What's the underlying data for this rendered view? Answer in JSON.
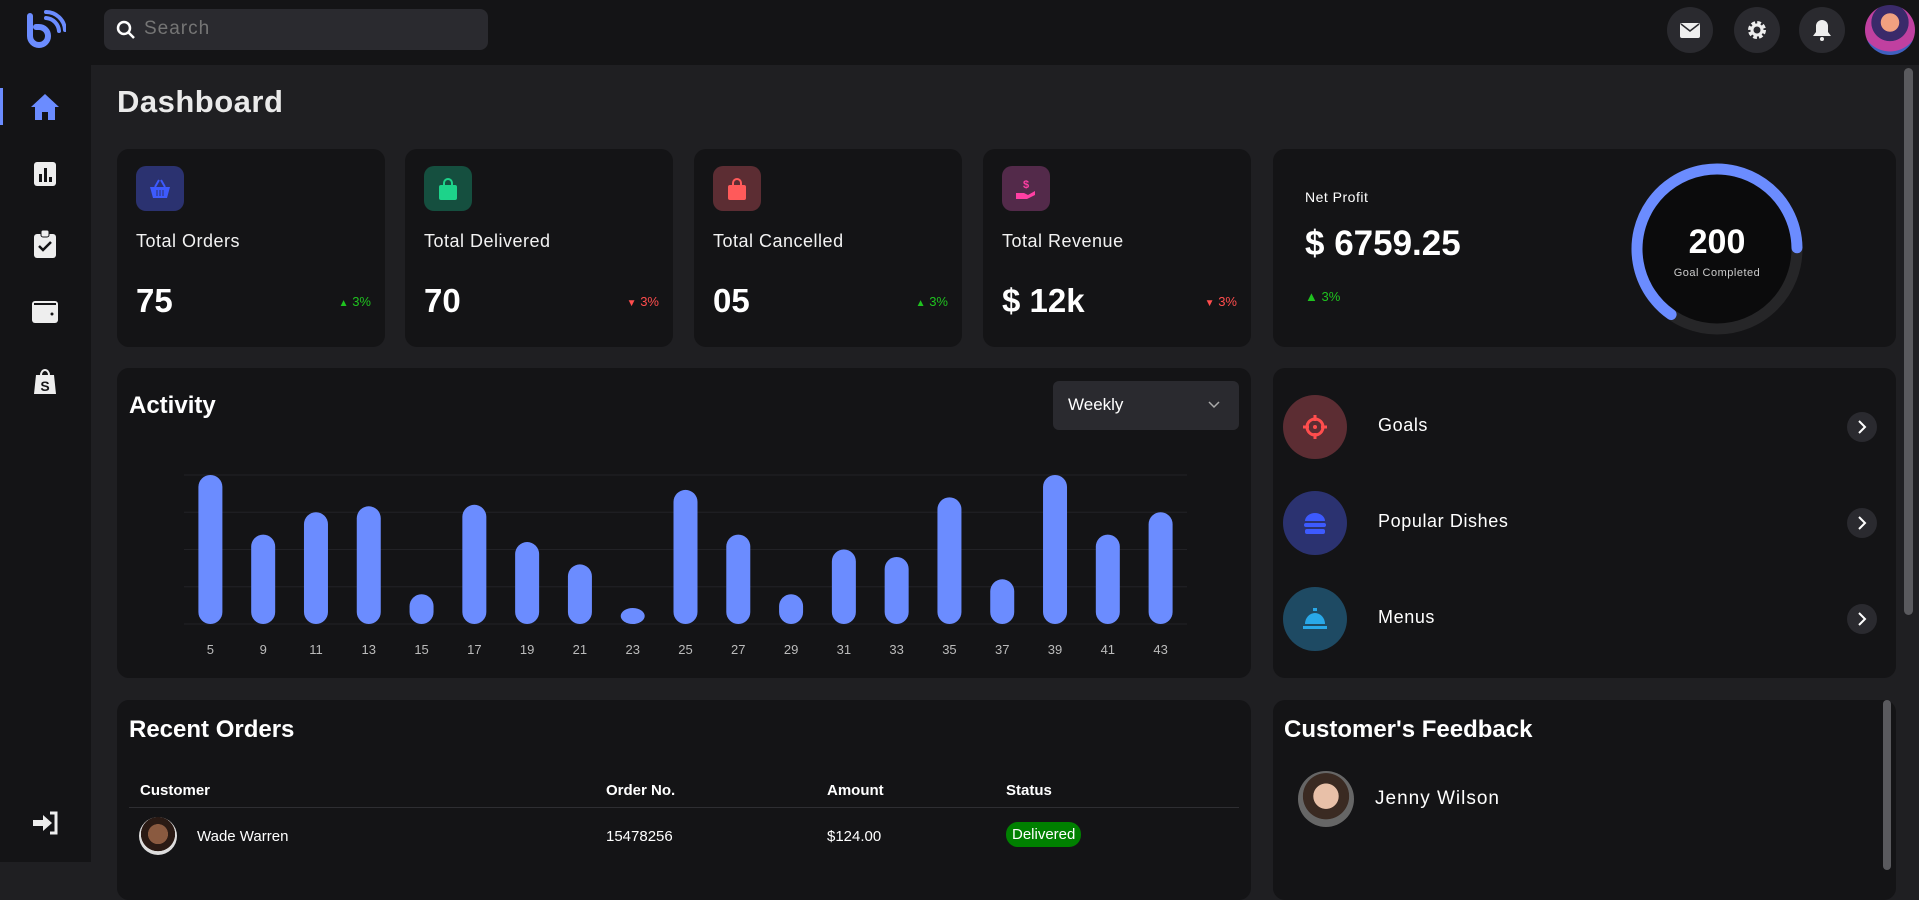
{
  "search": {
    "placeholder": "Search"
  },
  "header": {
    "icons": [
      "mail-icon",
      "gear-icon",
      "bell-icon"
    ],
    "avatar": "user-avatar"
  },
  "sidebar": {
    "items": [
      {
        "icon": "home-icon",
        "active": true
      },
      {
        "icon": "bar-chart-icon"
      },
      {
        "icon": "clipboard-check-icon"
      },
      {
        "icon": "wallet-icon"
      },
      {
        "icon": "shopify-bag-icon"
      }
    ],
    "logout_icon": "logout-icon",
    "accent": "#6b8cff"
  },
  "page_title": "Dashboard",
  "stats": [
    {
      "title": "Total Orders",
      "value": "75",
      "change": "3%",
      "trend": "up",
      "icon": "basket-icon",
      "color": "#3d5afe",
      "bg": "#2b3270"
    },
    {
      "title": "Total Delivered",
      "value": "70",
      "change": "3%",
      "trend": "down",
      "icon": "shopping-bag-icon",
      "color": "#1dd38a",
      "bg": "#154f3f"
    },
    {
      "title": "Total Cancelled",
      "value": "05",
      "change": "3%",
      "trend": "up",
      "icon": "shopping-bag-icon",
      "color": "#ff5a5a",
      "bg": "#5c2d33"
    },
    {
      "title": "Total Revenue",
      "value": "$ 12k",
      "change": "3%",
      "trend": "down",
      "icon": "hand-dollar-icon",
      "color": "#ff3fa4",
      "bg": "#532a4a"
    }
  ],
  "net_profit": {
    "label": "Net Profit",
    "value": "$ 6759.25",
    "change": "3%",
    "trend": "up",
    "goal_value": "200",
    "goal_label": "Goal Completed",
    "goal_progress": 0.65,
    "color": "#6b8cff"
  },
  "activity": {
    "title": "Activity",
    "dropdown": "Weekly"
  },
  "chart_data": {
    "type": "bar",
    "categories": [
      "5",
      "9",
      "11",
      "13",
      "15",
      "17",
      "19",
      "21",
      "23",
      "25",
      "27",
      "29",
      "31",
      "33",
      "35",
      "37",
      "39",
      "41",
      "43"
    ],
    "values": [
      100,
      60,
      75,
      79,
      20,
      80,
      55,
      40,
      10,
      90,
      60,
      20,
      50,
      45,
      85,
      30,
      100,
      60,
      75
    ],
    "ylim": [
      0,
      100
    ],
    "grid": true,
    "color": "#6b8cff"
  },
  "quick_links": [
    {
      "label": "Goals",
      "icon": "crosshair-icon",
      "color": "#ff4d4d",
      "bg": "#5c2d33"
    },
    {
      "label": "Popular Dishes",
      "icon": "burger-icon",
      "color": "#3d5afe",
      "bg": "#2b3270"
    },
    {
      "label": "Menus",
      "icon": "cloche-icon",
      "color": "#29a8e8",
      "bg": "#1e4a63"
    }
  ],
  "recent_orders": {
    "title": "Recent Orders",
    "columns": [
      "Customer",
      "Order No.",
      "Amount",
      "Status"
    ],
    "rows": [
      {
        "customer": "Wade Warren",
        "order_no": "15478256",
        "amount": "$124.00",
        "status": "Delivered"
      }
    ]
  },
  "feedback": {
    "title": "Customer's Feedback",
    "items": [
      {
        "name": "Jenny Wilson"
      }
    ]
  }
}
